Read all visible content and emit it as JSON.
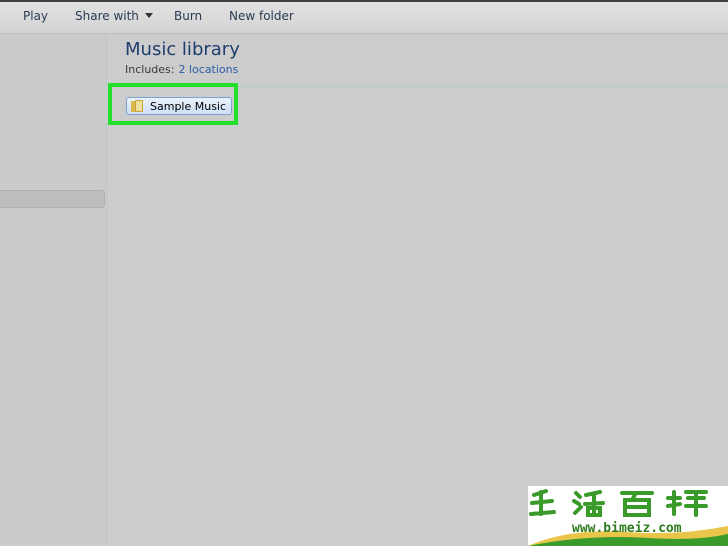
{
  "toolbar": {
    "play_label": "Play",
    "share_label": "Share with",
    "burn_label": "Burn",
    "new_folder_label": "New folder"
  },
  "library": {
    "title": "Music library",
    "includes_label": "Includes:",
    "locations_link": "2 locations"
  },
  "folder": {
    "label": "Sample Music",
    "icon": "folder-icon"
  },
  "watermark": {
    "url": "www.bimeiz.com",
    "accent": "#3a9b2a"
  }
}
